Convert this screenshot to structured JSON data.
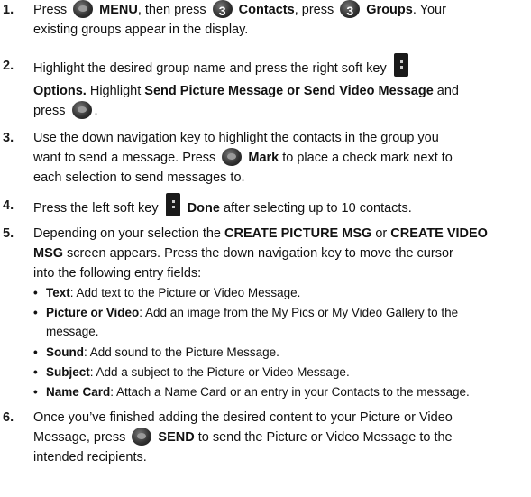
{
  "steps": {
    "s1": {
      "num": "1.",
      "press": "Press ",
      "menu": "MENU",
      "then": ", then press ",
      "contacts": "Contacts",
      "press2": ", press ",
      "groups": "Groups",
      "tail": ". Your",
      "line2": "existing groups appear in the display.",
      "menu_key": "3"
    },
    "s2": {
      "num": "2.",
      "line1": "Highlight the desired group name and press the right soft key",
      "options": "Options.",
      "highlight": " Highlight ",
      "send_pic": "Send Picture Message or Send Video Message",
      "and": " and",
      "press": "press ",
      "period": "."
    },
    "s3": {
      "num": "3.",
      "line1": "Use the down navigation key to highlight the contacts in the group you",
      "line2a": "want to send a message. Press ",
      "mark": "Mark",
      "line2b": " to place a check mark next to",
      "line3": "each selection to send messages to."
    },
    "s4": {
      "num": "4.",
      "pre": "Press the left soft key ",
      "done": "Done",
      "post": " after selecting up to 10 contacts."
    },
    "s5": {
      "num": "5.",
      "pre": "Depending on your selection the ",
      "create_pic": "CREATE PICTURE MSG",
      "or": " or ",
      "create_vid1": "CREATE VIDEO",
      "create_vid2": "MSG",
      "line2b": " screen appears. Press the down navigation key to move the cursor",
      "line3": "into the following entry fields:"
    },
    "bullets": [
      {
        "label": "Text",
        "text": ": Add text to the Picture or Video Message."
      },
      {
        "label": "Picture or Video",
        "text": ": Add an image from the My Pics or My Video Gallery to the",
        "text2": "message."
      },
      {
        "label": "Sound",
        "text": ": Add sound to the Picture Message."
      },
      {
        "label": "Subject",
        "text": ": Add a subject to the Picture or Video Message."
      },
      {
        "label": "Name Card",
        "text": ": Attach a Name Card or an entry in your Contacts to the message."
      }
    ],
    "s6": {
      "num": "6.",
      "line1": "Once you’ve finished adding the desired content to your Picture or Video",
      "line2a": "Message, press ",
      "send": "SEND",
      "line2b": " to send the Picture or Video Message to the",
      "line3": "intended recipients."
    }
  },
  "bullet_glyph": "•",
  "icons": {
    "center_key": "ok-key-icon",
    "number_key": "number-3-key-icon",
    "soft_key": "soft-key-icon"
  }
}
